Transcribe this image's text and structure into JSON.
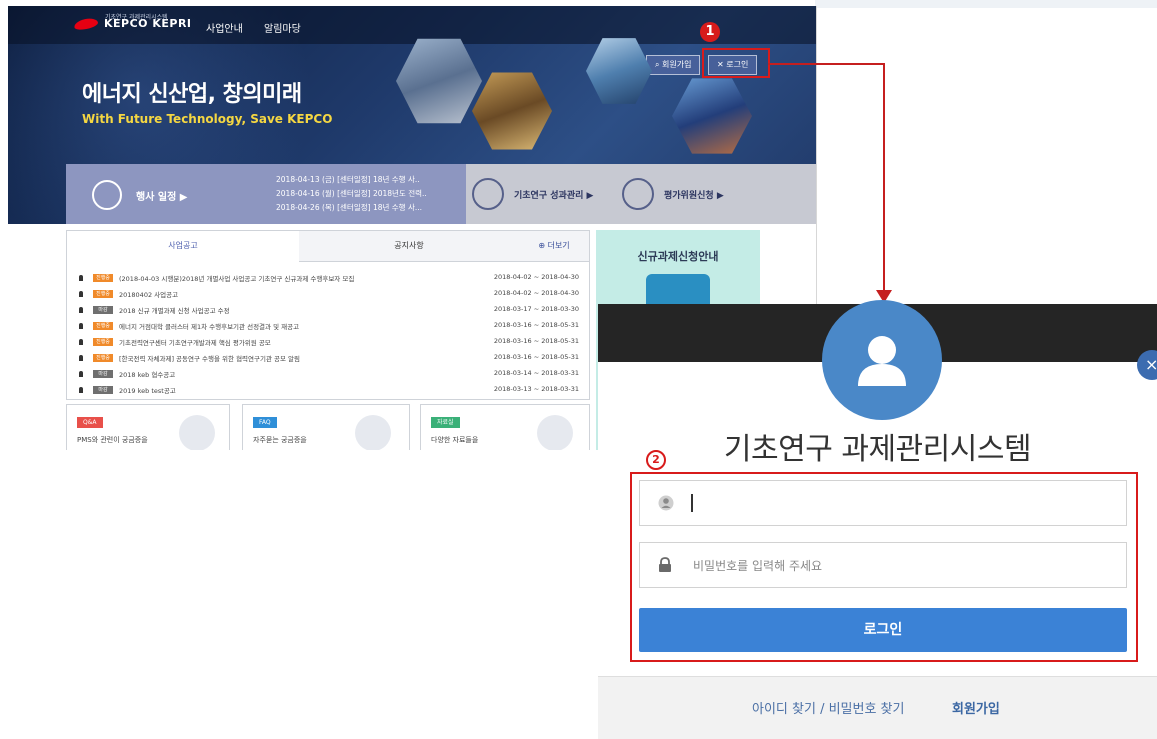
{
  "site": {
    "logo": {
      "brand": "KEPCO KEPRI",
      "sub": "기초연구 과제관리시스템"
    },
    "nav": [
      "사업안내",
      "알림마당"
    ],
    "hero_buttons": {
      "join": "회원가입",
      "login": "로그인"
    },
    "hero": {
      "title": "에너지 신산업, 창의미래",
      "subtitle": "With Future Technology, Save KEPCO"
    },
    "quickbar": {
      "schedule_label": "행사 일정 ▶",
      "schedule": [
        "2018-04-13 (금) [센터일정] 18년 수행 사..",
        "2018-04-16 (월) [센터일정] 2018년도 전력..",
        "2018-04-26 (목) [센터일정] 18년 수행 사..."
      ],
      "research_link": "기초연구 성과관리 ▶",
      "eval_link": "평가위원신청 ▶"
    },
    "tabs": {
      "notice": "사업공고",
      "news": "공지사항",
      "more": "더보기"
    },
    "notices": [
      {
        "tag": "진행중",
        "title": "(2018-04-03 시행분)2018년 개별사업 사업공고 기초연구 신규과제 수행후보자 모집",
        "date": "2018-04-02 ~ 2018-04-30"
      },
      {
        "tag": "진행중",
        "title": "20180402 사업공고",
        "date": "2018-04-02 ~ 2018-04-30"
      },
      {
        "tag": "마감",
        "title": "2018 신규 개별과제 신청 사업공고 수정",
        "date": "2018-03-17 ~ 2018-03-30"
      },
      {
        "tag": "진행중",
        "title": "에너지 거점대학 클러스터 제1차 수행후보기관 선정결과 및 재공고",
        "date": "2018-03-16 ~ 2018-05-31"
      },
      {
        "tag": "진행중",
        "title": "기초전력연구센터 기초연구개발과제 핵심 평가위원 공모",
        "date": "2018-03-16 ~ 2018-05-31"
      },
      {
        "tag": "진행중",
        "title": "[한국전력 자체과제] 공동연구 수행을 위한 협력연구기관 공모 알림",
        "date": "2018-03-16 ~ 2018-05-31"
      },
      {
        "tag": "마감",
        "title": "2018 keb 협수공고",
        "date": "2018-03-14 ~ 2018-03-31"
      },
      {
        "tag": "마감",
        "title": "2019 keb test공고",
        "date": "2018-03-13 ~ 2018-03-31"
      }
    ],
    "cards": [
      {
        "pill": "Q&A",
        "text": "PMS와 관련이 궁금증을"
      },
      {
        "pill": "FAQ",
        "text": "자주묻는 궁금증을"
      },
      {
        "pill": "자료실",
        "text": "다양한 자료들을"
      }
    ],
    "promo_title": "신규과제신청안내"
  },
  "annotations": {
    "step1": "1",
    "step2": "2"
  },
  "modal": {
    "title": "기초연구 과제관리시스템",
    "id_value": "",
    "password_placeholder": "비밀번호를 입력해 주세요",
    "login_button": "로그인",
    "find_links": "아이디 찾기 / 비밀번호 찾기",
    "join_link": "회원가입",
    "close_symbol": "×"
  },
  "colors": {
    "accent": "#3b82d6",
    "annotation": "#d81b1b",
    "modal_header": "#252525"
  }
}
